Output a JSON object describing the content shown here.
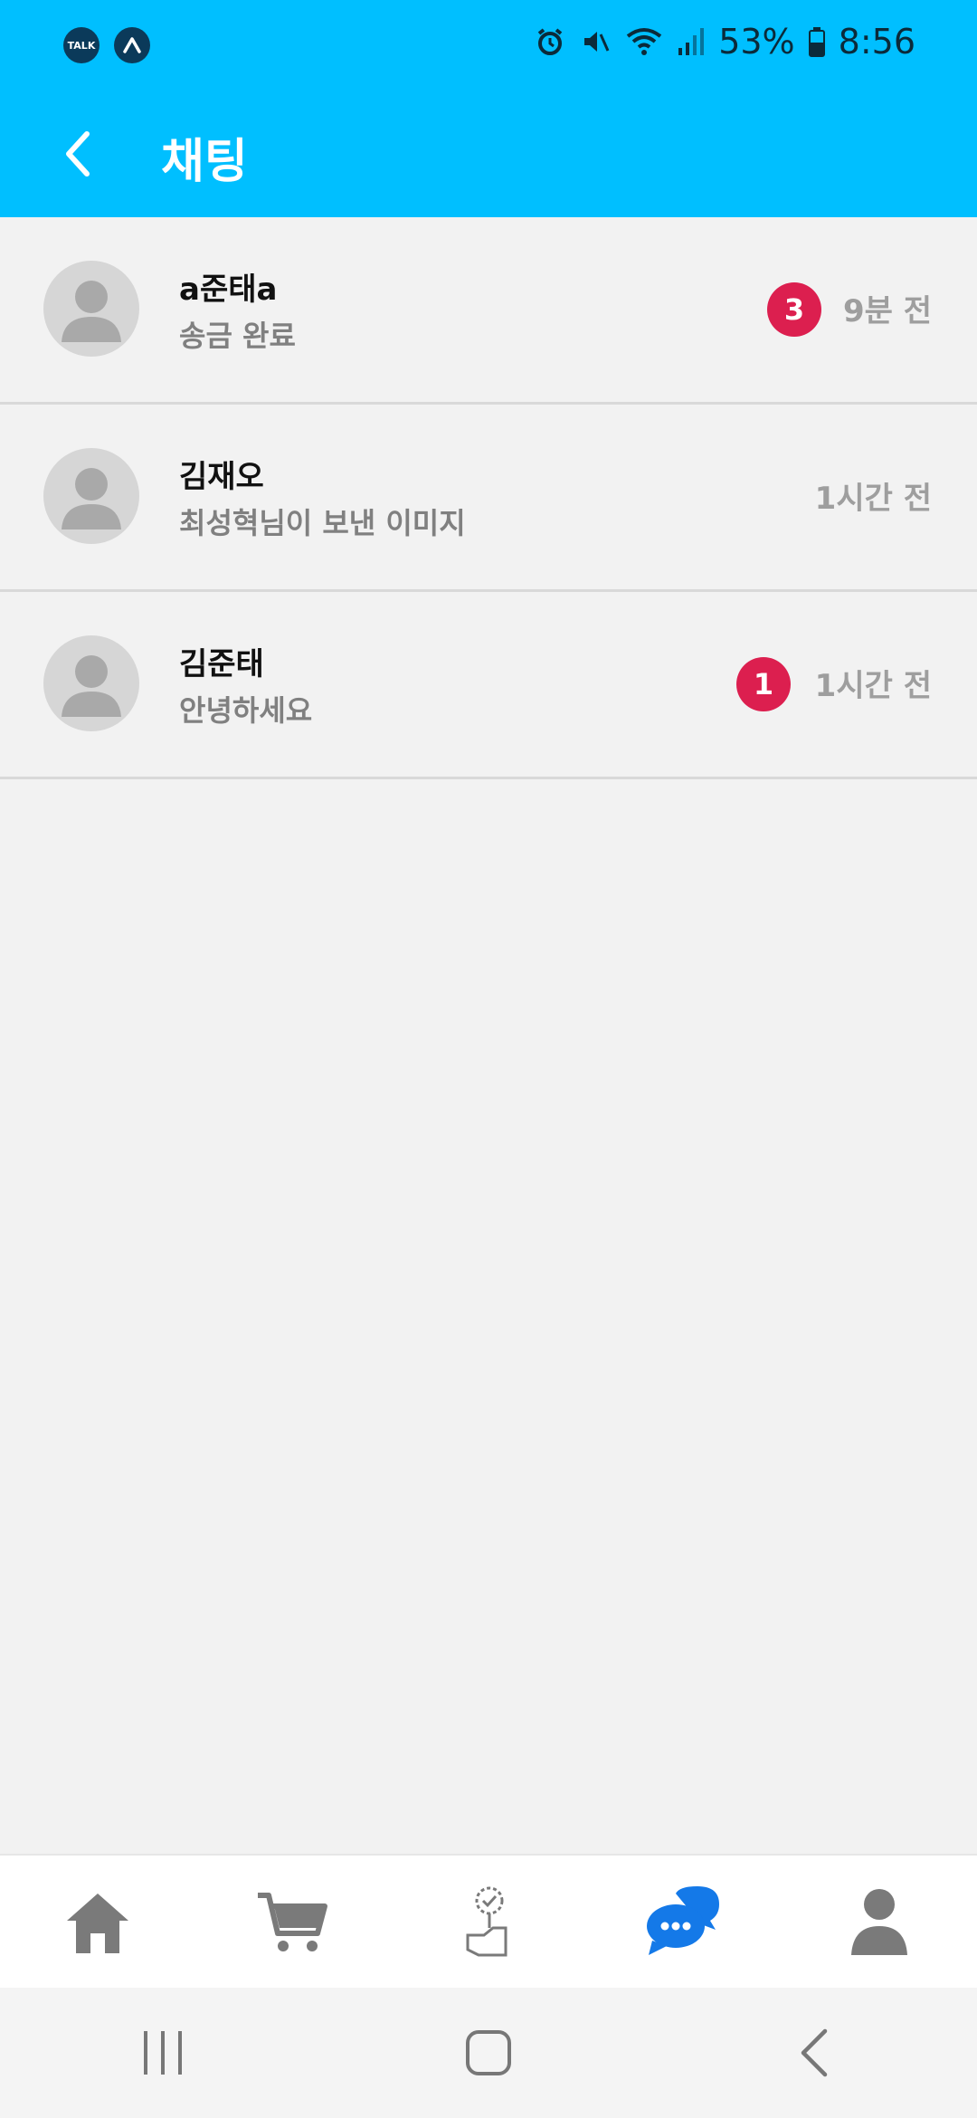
{
  "status_bar": {
    "battery": "53%",
    "time": "8:56",
    "left_icons": [
      "kakaotalk-icon",
      "app-notification-icon"
    ],
    "right_icons": [
      "alarm-icon",
      "mute-icon",
      "wifi-icon",
      "signal-icon",
      "battery-icon"
    ],
    "kakaotalk_label": "TALK"
  },
  "header": {
    "title": "채팅",
    "back_icon": "chevron-left-icon",
    "background": "#00bfff"
  },
  "chats": [
    {
      "name": "a준태a",
      "preview": "송금 완료",
      "time": "9분 전",
      "unread": "3"
    },
    {
      "name": "김재오",
      "preview": "최성혁님이 보낸 이미지",
      "time": "1시간 전",
      "unread": ""
    },
    {
      "name": "김준태",
      "preview": "안녕하세요",
      "time": "1시간 전",
      "unread": "1"
    }
  ],
  "bottom_nav": {
    "items": [
      {
        "icon": "home-icon",
        "active": false
      },
      {
        "icon": "cart-icon",
        "active": false
      },
      {
        "icon": "review-check-icon",
        "active": false
      },
      {
        "icon": "chat-icon",
        "active": true
      },
      {
        "icon": "profile-icon",
        "active": false
      }
    ],
    "active_color": "#1479e8",
    "inactive_color": "#7a7a7a"
  },
  "system_nav": {
    "items": [
      "recent-apps-icon",
      "home-button-icon",
      "back-icon"
    ]
  },
  "colors": {
    "badge": "#dc1f4f",
    "avatar_bg": "#d6d6d6",
    "avatar_fg": "#a9a9a9"
  }
}
